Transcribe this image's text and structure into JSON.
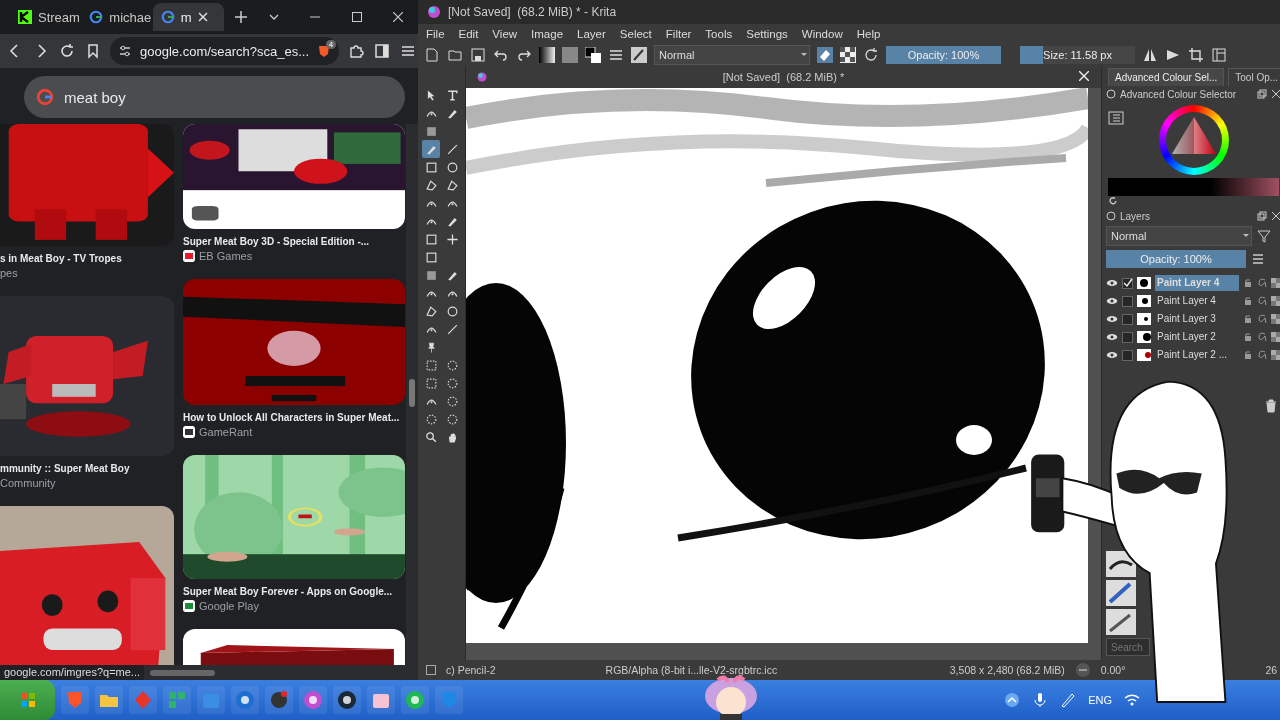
{
  "browser": {
    "tabs": [
      {
        "label": "Stream",
        "selected": false
      },
      {
        "label": "michae",
        "selected": false
      },
      {
        "label": "m",
        "selected": true
      }
    ],
    "address": "google.com/search?sca_es...",
    "extension_badge": "4",
    "search": {
      "value": "meat boy"
    },
    "results_left": [
      {
        "title": "s in Meat Boy - TV Tropes",
        "source": "pes"
      },
      {
        "title": "mmunity :: Super Meat Boy",
        "source": "Community"
      }
    ],
    "results_right": [
      {
        "title": "Super Meat Boy 3D - Special Edition -...",
        "source": "EB Games"
      },
      {
        "title": "How to Unlock All Characters in Super Meat...",
        "source": "GameRant"
      },
      {
        "title": "Super Meat Boy Forever - Apps on Google...",
        "source": "Google Play"
      }
    ],
    "status_link": "google.com/imgres?q=me..."
  },
  "krita": {
    "title": "[Not Saved]  (68.2 MiB) * - Krita",
    "menu": [
      "File",
      "Edit",
      "View",
      "Image",
      "Layer",
      "Select",
      "Filter",
      "Tools",
      "Settings",
      "Window",
      "Help"
    ],
    "blend_mode": "Normal",
    "opacity": {
      "label": "Opacity: 100%",
      "level": 1
    },
    "size": {
      "label": "Size: 11.58 px",
      "level": 0.2
    },
    "document_tab": "[Not Saved]  (68.2 MiB) *",
    "tools": [
      {
        "selected": false
      },
      {
        "selected": false
      },
      {
        "selected": false
      },
      {
        "selected": false
      },
      {
        "selected": false
      },
      {
        "selected": true
      },
      {
        "selected": false
      },
      {
        "selected": false
      },
      {
        "selected": false
      },
      {
        "selected": false
      },
      {
        "selected": false
      },
      {
        "selected": false
      },
      {
        "selected": false
      },
      {
        "selected": false
      },
      {
        "selected": false
      },
      {
        "selected": false
      },
      {
        "selected": false
      },
      {
        "selected": false
      },
      {
        "selected": false
      },
      {
        "selected": false
      },
      {
        "selected": false
      },
      {
        "selected": false
      },
      {
        "selected": false
      },
      {
        "selected": false
      },
      {
        "selected": false
      },
      {
        "selected": false
      },
      {
        "selected": false
      },
      {
        "selected": false
      },
      {
        "selected": false
      },
      {
        "selected": false
      },
      {
        "selected": false
      },
      {
        "selected": false
      },
      {
        "selected": false
      },
      {
        "selected": false
      },
      {
        "selected": false
      },
      {
        "selected": false
      },
      {
        "selected": false
      }
    ],
    "docker_tabs": [
      {
        "label": "Advanced Colour Sel...",
        "selected": true
      },
      {
        "label": "Tool Op...",
        "selected": false
      }
    ],
    "colour_selector": {
      "title": "Advanced Colour Selector"
    },
    "layers": {
      "title": "Layers",
      "blend_mode": "Normal",
      "opacity": {
        "label": "Opacity: 100%",
        "level": 1
      },
      "items": [
        {
          "name": "Paint Layer 4",
          "selected": true,
          "visible": true
        },
        {
          "name": "Paint Layer 4",
          "selected": false,
          "visible": true
        },
        {
          "name": "Paint Layer 3",
          "selected": false,
          "visible": true
        },
        {
          "name": "Paint Layer 2",
          "selected": false,
          "visible": true
        },
        {
          "name": "Paint Layer 2 ...",
          "selected": false,
          "visible": true
        }
      ]
    },
    "presets": {
      "search_placeholder": "Search"
    },
    "status": {
      "tool": "c) Pencil-2",
      "colour_space": "RGB/Alpha (8-bit i...lle-V2-srgbtrc.icc",
      "dimensions": "3,508 x 2,480 (68.2 MiB)",
      "rotation": "0.00°",
      "zoom": "26"
    }
  },
  "taskbar": {
    "language": "ENG"
  }
}
